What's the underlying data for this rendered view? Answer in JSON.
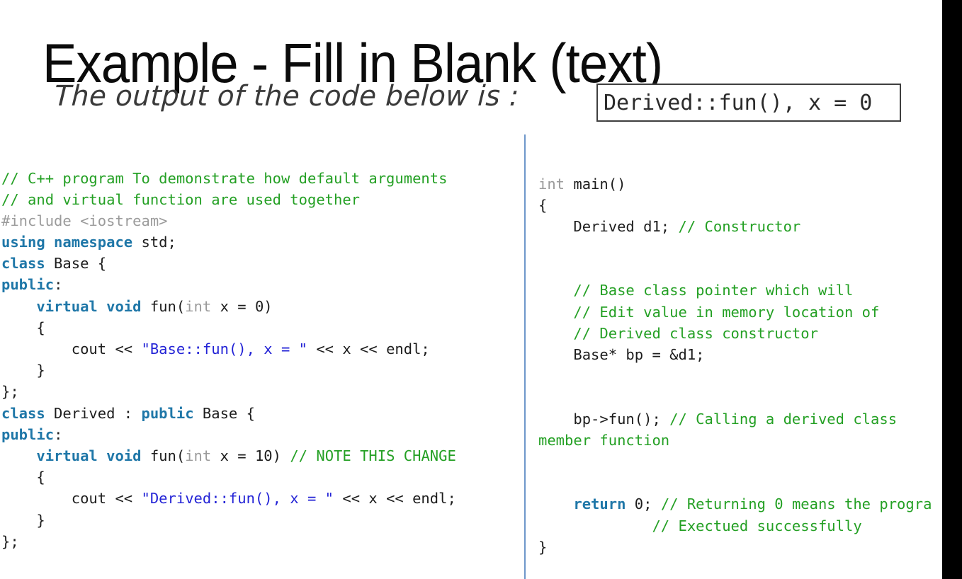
{
  "slide": {
    "title": "Example - Fill in Blank (text)",
    "prompt": "The output of the code below is :",
    "answer_value": "Derived::fun(), x = 0",
    "divider_color": "#6e97ca",
    "right_bar_color": "#000000"
  },
  "colors": {
    "comment": "#24a024",
    "keyword": "#1f77a8",
    "type": "#9b9b9b",
    "preprocessor": "#9b9b9b",
    "string": "#2323d6",
    "plain": "#1d1d1d",
    "title": "#0b0b0b",
    "prompt": "#3a3a3a",
    "answer_border": "#3f3f3f"
  },
  "code_left": [
    [
      {
        "t": "cmt",
        "s": "// C++ program To demonstrate how default arguments"
      }
    ],
    [
      {
        "t": "cmt",
        "s": "// and virtual function are used together"
      }
    ],
    [
      {
        "t": "pre",
        "s": "#include <iostream>"
      }
    ],
    [
      {
        "t": "kw",
        "s": "using namespace"
      },
      {
        "t": "pln",
        "s": " std;"
      }
    ],
    [
      {
        "t": "kw",
        "s": "class"
      },
      {
        "t": "pln",
        "s": " Base {"
      }
    ],
    [
      {
        "t": "kw",
        "s": "public"
      },
      {
        "t": "pln",
        "s": ":"
      }
    ],
    [
      {
        "t": "pln",
        "s": "    "
      },
      {
        "t": "kw",
        "s": "virtual void"
      },
      {
        "t": "pln",
        "s": " fun("
      },
      {
        "t": "type",
        "s": "int"
      },
      {
        "t": "pln",
        "s": " x = 0)"
      }
    ],
    [
      {
        "t": "pln",
        "s": "    {"
      }
    ],
    [
      {
        "t": "pln",
        "s": "        cout << "
      },
      {
        "t": "str",
        "s": "\"Base::fun(), x = \""
      },
      {
        "t": "pln",
        "s": " << x << endl;"
      }
    ],
    [
      {
        "t": "pln",
        "s": "    }"
      }
    ],
    [
      {
        "t": "pln",
        "s": "};"
      }
    ],
    [
      {
        "t": "kw",
        "s": "class"
      },
      {
        "t": "pln",
        "s": " Derived : "
      },
      {
        "t": "kw",
        "s": "public"
      },
      {
        "t": "pln",
        "s": " Base {"
      }
    ],
    [
      {
        "t": "kw",
        "s": "public"
      },
      {
        "t": "pln",
        "s": ":"
      }
    ],
    [
      {
        "t": "pln",
        "s": "    "
      },
      {
        "t": "kw",
        "s": "virtual void"
      },
      {
        "t": "pln",
        "s": " fun("
      },
      {
        "t": "type",
        "s": "int"
      },
      {
        "t": "pln",
        "s": " x = 10) "
      },
      {
        "t": "cmt",
        "s": "// NOTE THIS CHANGE"
      }
    ],
    [
      {
        "t": "pln",
        "s": "    {"
      }
    ],
    [
      {
        "t": "pln",
        "s": "        cout << "
      },
      {
        "t": "str",
        "s": "\"Derived::fun(), x = \""
      },
      {
        "t": "pln",
        "s": " << x << endl;"
      }
    ],
    [
      {
        "t": "pln",
        "s": "    }"
      }
    ],
    [
      {
        "t": "pln",
        "s": "};"
      }
    ]
  ],
  "code_right": [
    [
      {
        "t": "type",
        "s": "int"
      },
      {
        "t": "pln",
        "s": " main()"
      }
    ],
    [
      {
        "t": "pln",
        "s": "{"
      }
    ],
    [
      {
        "t": "pln",
        "s": "    Derived d1; "
      },
      {
        "t": "cmt",
        "s": "// Constructor"
      }
    ],
    [
      {
        "t": "pln",
        "s": ""
      }
    ],
    [
      {
        "t": "pln",
        "s": ""
      }
    ],
    [
      {
        "t": "pln",
        "s": "    "
      },
      {
        "t": "cmt",
        "s": "// Base class pointer which will"
      }
    ],
    [
      {
        "t": "pln",
        "s": "    "
      },
      {
        "t": "cmt",
        "s": "// Edit value in memory location of"
      }
    ],
    [
      {
        "t": "pln",
        "s": "    "
      },
      {
        "t": "cmt",
        "s": "// Derived class constructor"
      }
    ],
    [
      {
        "t": "pln",
        "s": "    Base* bp = &d1;"
      }
    ],
    [
      {
        "t": "pln",
        "s": ""
      }
    ],
    [
      {
        "t": "pln",
        "s": ""
      }
    ],
    [
      {
        "t": "pln",
        "s": "    bp->fun(); "
      },
      {
        "t": "cmt",
        "s": "// Calling a derived class"
      }
    ],
    [
      {
        "t": "cmt",
        "s": "member function"
      }
    ],
    [
      {
        "t": "pln",
        "s": ""
      }
    ],
    [
      {
        "t": "pln",
        "s": ""
      }
    ],
    [
      {
        "t": "pln",
        "s": "    "
      },
      {
        "t": "kw",
        "s": "return"
      },
      {
        "t": "pln",
        "s": " 0; "
      },
      {
        "t": "cmt",
        "s": "// Returning 0 means the progra"
      }
    ],
    [
      {
        "t": "pln",
        "s": "             "
      },
      {
        "t": "cmt",
        "s": "// Exectued successfully"
      }
    ],
    [
      {
        "t": "pln",
        "s": "}"
      }
    ]
  ]
}
